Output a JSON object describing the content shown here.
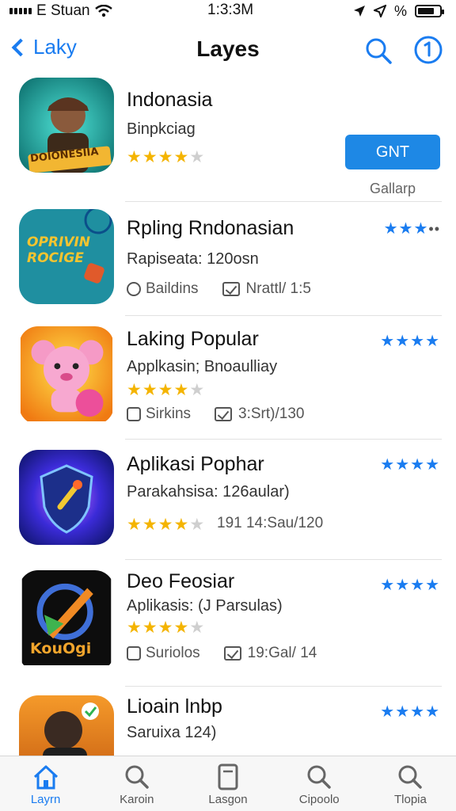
{
  "status_bar": {
    "carrier": "E Stuan",
    "time": "1:3:3M",
    "battery_text": "%",
    "battery_level": 0.75
  },
  "nav": {
    "back_label": "Laky",
    "title": "Layes"
  },
  "apps": [
    {
      "name": "Indonasia",
      "subtitle": "Binpkciag",
      "rating": 3.5,
      "icon_text": "DOIONESIIA",
      "get_label": "GNT",
      "get_caption": "Gallarp"
    },
    {
      "name": "Rpling Rndonasian",
      "subtitle": "Rapiseata: 120osn",
      "icon_text": "OPRIVIN ROCIGE",
      "meta_left": "Baildins",
      "meta_right": "Nrattl/ 1:5",
      "right_rating": "★★★",
      "right_dots": "••"
    },
    {
      "name": "Laking Popular",
      "subtitle": "Applkasin; Bnoaulliay",
      "rating": 3.5,
      "meta_left": "Sirkins",
      "meta_right": "3:Srt)/130",
      "right_rating": "★★★★"
    },
    {
      "name": "Aplikasi Pophar",
      "subtitle": "Parakahsisa: 126aular)",
      "rating": 3.5,
      "meta_right": "191 14:Sau/120",
      "right_rating": "★★★★"
    },
    {
      "name": "Deo Feosiar",
      "subtitle": "Aplikasis: (J Parsulas)",
      "rating": 3.5,
      "icon_text": "KouOgi",
      "meta_left": "Suriolos",
      "meta_right": "19:Gal/ 14",
      "right_rating": "★★★★"
    },
    {
      "name": "Lioain lnbp",
      "subtitle": "Saruixa 124)",
      "right_rating": "★★★★"
    }
  ],
  "tabs": [
    {
      "label": "Layrn",
      "icon": "home-icon",
      "active": true
    },
    {
      "label": "Karoin",
      "icon": "search-icon"
    },
    {
      "label": "Lasgon",
      "icon": "document-icon"
    },
    {
      "label": "Cipoolo",
      "icon": "search-icon"
    },
    {
      "label": "Tlopia",
      "icon": "search-icon"
    }
  ],
  "colors": {
    "accent": "#1a7cf0",
    "star": "#f4b400",
    "button": "#1e88e5"
  }
}
